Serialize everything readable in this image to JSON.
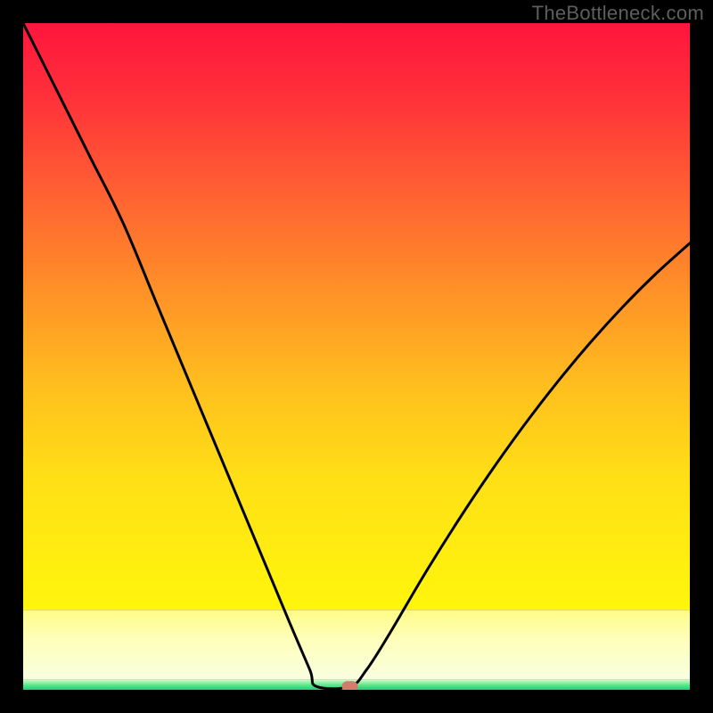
{
  "watermark": "TheBottleneck.com",
  "chart_data": {
    "type": "line",
    "title": "",
    "xlabel": "",
    "ylabel": "",
    "xlim": [
      0,
      1
    ],
    "ylim": [
      0,
      1
    ],
    "curve": {
      "name": "bottleneck-curve",
      "points": [
        {
          "x": 0.0,
          "y": 1.0
        },
        {
          "x": 0.05,
          "y": 0.9
        },
        {
          "x": 0.1,
          "y": 0.8
        },
        {
          "x": 0.15,
          "y": 0.7
        },
        {
          "x": 0.2,
          "y": 0.58
        },
        {
          "x": 0.25,
          "y": 0.46
        },
        {
          "x": 0.3,
          "y": 0.34
        },
        {
          "x": 0.35,
          "y": 0.22
        },
        {
          "x": 0.4,
          "y": 0.1
        },
        {
          "x": 0.43,
          "y": 0.03
        },
        {
          "x": 0.44,
          "y": 0.005
        },
        {
          "x": 0.49,
          "y": 0.005
        },
        {
          "x": 0.515,
          "y": 0.03
        },
        {
          "x": 0.55,
          "y": 0.085
        },
        {
          "x": 0.6,
          "y": 0.17
        },
        {
          "x": 0.65,
          "y": 0.25
        },
        {
          "x": 0.7,
          "y": 0.325
        },
        {
          "x": 0.75,
          "y": 0.395
        },
        {
          "x": 0.8,
          "y": 0.46
        },
        {
          "x": 0.85,
          "y": 0.52
        },
        {
          "x": 0.9,
          "y": 0.575
        },
        {
          "x": 0.95,
          "y": 0.625
        },
        {
          "x": 1.0,
          "y": 0.67
        }
      ]
    },
    "marker": {
      "x": 0.49,
      "y": 0.005,
      "color": "#d9786b"
    },
    "bands": {
      "green_start": 0.0,
      "green_end": 0.015,
      "pale_start": 0.015,
      "pale_end": 0.12
    }
  }
}
